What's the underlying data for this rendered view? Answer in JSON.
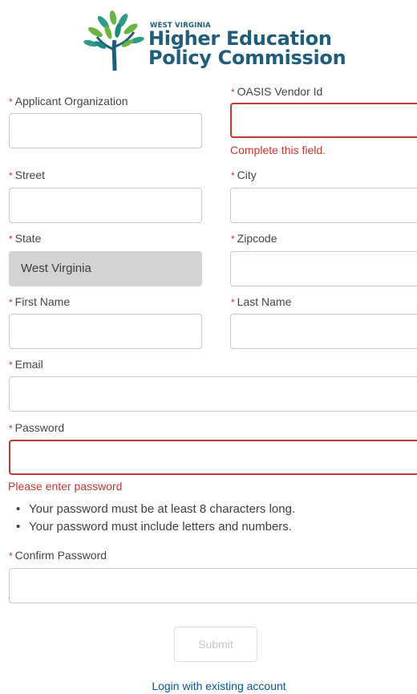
{
  "logo": {
    "small": "WEST VIRGINIA",
    "line1": "Higher Education",
    "line2": "Policy Commission"
  },
  "required_mark": "*",
  "fields": {
    "applicant_org": {
      "label": "Applicant Organization",
      "value": ""
    },
    "vendor_id": {
      "label": "OASIS Vendor Id",
      "value": "",
      "error": "Complete this field."
    },
    "street": {
      "label": "Street",
      "value": ""
    },
    "city": {
      "label": "City",
      "value": ""
    },
    "state": {
      "label": "State",
      "value": "West Virginia"
    },
    "zipcode": {
      "label": "Zipcode",
      "value": ""
    },
    "first_name": {
      "label": "First Name",
      "value": ""
    },
    "last_name": {
      "label": "Last Name",
      "value": ""
    },
    "email": {
      "label": "Email",
      "value": ""
    },
    "password": {
      "label": "Password",
      "value": "",
      "error": "Please enter password"
    },
    "confirm_password": {
      "label": "Confirm Password",
      "value": ""
    }
  },
  "password_rules": [
    "Your password must be at least 8 characters long.",
    "Your password must include letters and numbers."
  ],
  "submit_label": "Submit",
  "login_link": "Login with existing account",
  "colors": {
    "brand": "#1f5d7a",
    "leaf_green": "#6db33f",
    "error": "#c23934",
    "link": "#0b5394"
  }
}
